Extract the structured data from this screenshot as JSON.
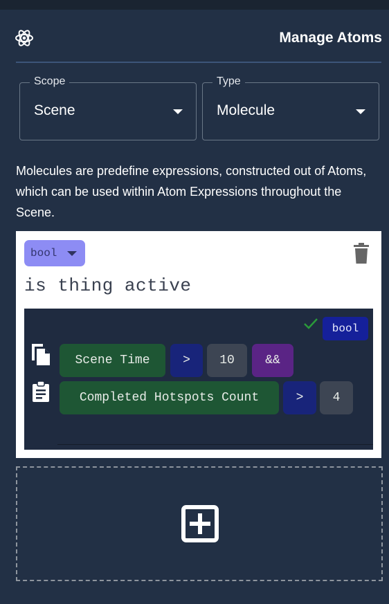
{
  "header": {
    "title": "Manage Atoms",
    "icon": "atom-icon"
  },
  "selects": {
    "scope": {
      "label": "Scope",
      "value": "Scene"
    },
    "type": {
      "label": "Type",
      "value": "Molecule"
    }
  },
  "description": "Molecules are predefine expressions, constructed out of Atoms, which can be used within Atom Expressions throughout the Scene.",
  "molecule": {
    "type": "bool",
    "name": "is thing active",
    "return_type": "bool",
    "valid": true,
    "expression_lines": [
      [
        {
          "kind": "variable",
          "text": "Scene Time"
        },
        {
          "kind": "operator",
          "text": ">"
        },
        {
          "kind": "number",
          "text": "10"
        },
        {
          "kind": "logic",
          "text": "&&"
        }
      ],
      [
        {
          "kind": "variable",
          "text": "Completed Hotspots Count"
        },
        {
          "kind": "operator",
          "text": ">"
        },
        {
          "kind": "number",
          "text": "4"
        }
      ]
    ]
  },
  "icons": {
    "delete": "trash-icon",
    "copy": "copy-icon",
    "paste": "clipboard-icon",
    "check": "check-icon",
    "add": "add-box-icon"
  },
  "colors": {
    "background": "#223045",
    "card": "#ffffff",
    "type_pill": "#8d8cf4",
    "editor": "#1f2b40",
    "variable_token": "#1e5634",
    "operator_token": "#18247a",
    "number_token": "#3d4553",
    "logic_token": "#5a2485",
    "return_pill": "#15209a",
    "valid_check": "#2a9a3a"
  }
}
